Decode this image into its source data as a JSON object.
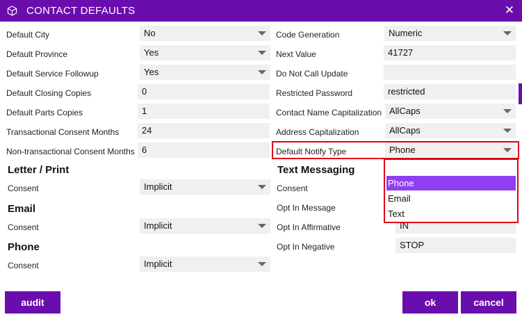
{
  "title": "CONTACT DEFAULTS",
  "left_fields": [
    {
      "label": "Default City",
      "value": "No",
      "dropdown": true
    },
    {
      "label": "Default Province",
      "value": "Yes",
      "dropdown": true
    },
    {
      "label": "Default Service Followup",
      "value": "Yes",
      "dropdown": true
    },
    {
      "label": "Default Closing Copies",
      "value": "0",
      "dropdown": false
    },
    {
      "label": "Default Parts Copies",
      "value": "1",
      "dropdown": false
    },
    {
      "label": "Transactional Consent Months",
      "value": "24",
      "dropdown": false
    },
    {
      "label": "Non-transactional Consent Months",
      "value": "6",
      "dropdown": false
    }
  ],
  "right_fields": [
    {
      "label": "Code Generation",
      "value": "Numeric",
      "dropdown": true
    },
    {
      "label": "Next Value",
      "value": "41727",
      "dropdown": false
    },
    {
      "label": "Do Not Call Update",
      "value": "",
      "dropdown": false
    },
    {
      "label": "Restricted Password",
      "value": "restricted",
      "dropdown": false
    },
    {
      "label": "Contact Name Capitalization",
      "value": "AllCaps",
      "dropdown": true
    },
    {
      "label": "Address Capitalization",
      "value": "AllCaps",
      "dropdown": true
    },
    {
      "label": "Default Notify Type",
      "value": "Phone",
      "dropdown": true
    }
  ],
  "sections": {
    "letter": {
      "heading": "Letter / Print",
      "consent_label": "Consent",
      "consent_value": "Implicit"
    },
    "email": {
      "heading": "Email",
      "consent_label": "Consent",
      "consent_value": "Implicit"
    },
    "phone": {
      "heading": "Phone",
      "consent_label": "Consent",
      "consent_value": "Implicit"
    }
  },
  "text_messaging": {
    "heading": "Text Messaging",
    "consent_label": "Consent",
    "opt_in_message_label": "Opt In Message",
    "opt_in_affirmative_label": "Opt In Affirmative",
    "opt_in_affirmative_value": "IN",
    "opt_in_negative_label": "Opt In Negative",
    "opt_in_negative_value": "STOP"
  },
  "notify_dropdown": {
    "options": [
      "Phone",
      "Email",
      "Text"
    ],
    "selected": "Phone"
  },
  "buttons": {
    "audit": "audit",
    "ok": "ok",
    "cancel": "cancel"
  },
  "colors": {
    "accent": "#6a0dad",
    "highlight": "#e0001a",
    "selected_option": "#8f3ff0",
    "field_bg": "#f0f0f0"
  },
  "icons": {
    "title": "cube-icon",
    "close": "close-icon",
    "dropdown": "chevron-down-icon"
  }
}
